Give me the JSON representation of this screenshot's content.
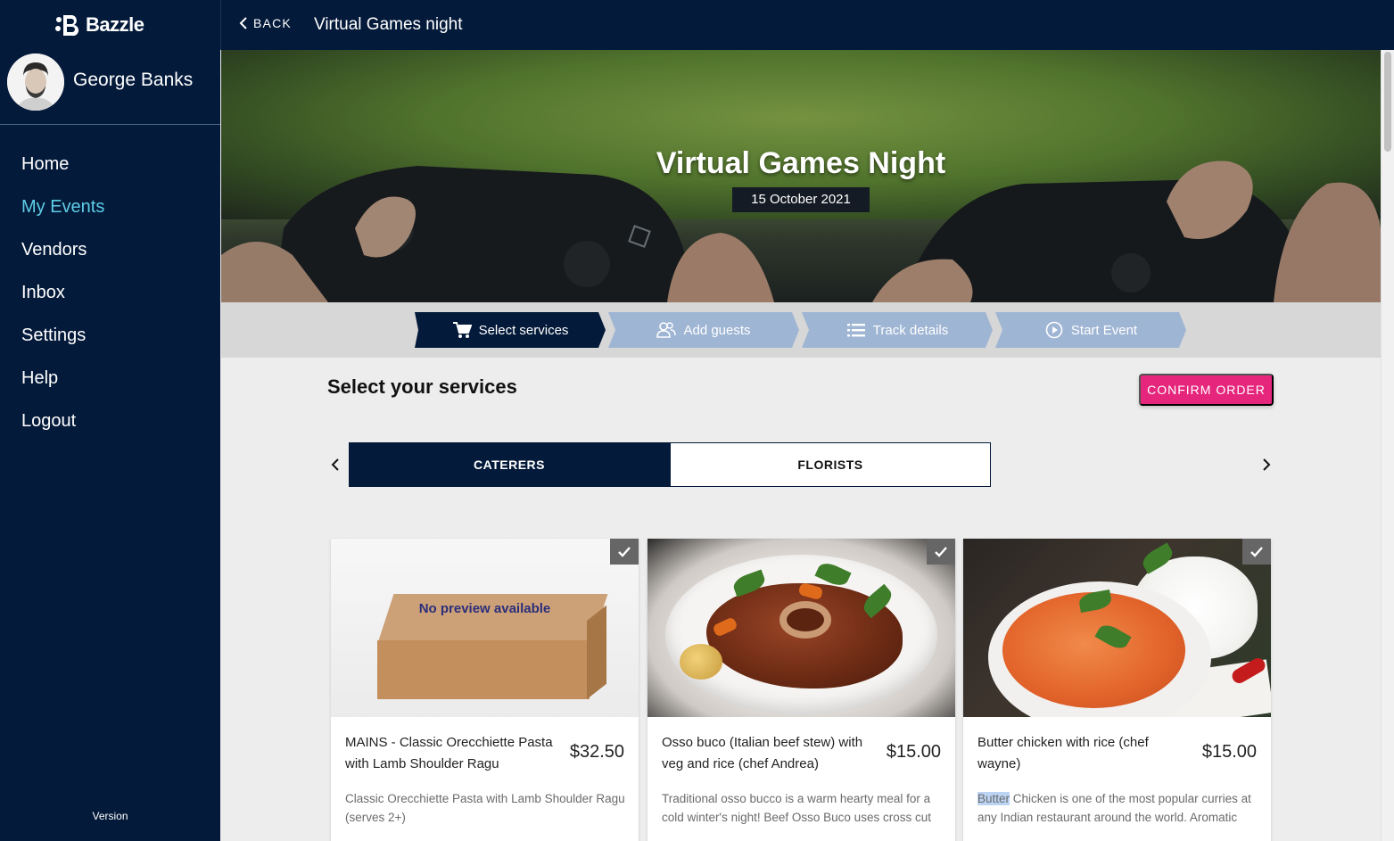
{
  "app": {
    "logo_text": "Bazzle"
  },
  "user": {
    "name": "George Banks"
  },
  "sidebar": {
    "items": [
      {
        "label": "Home",
        "active": false
      },
      {
        "label": "My Events",
        "active": true
      },
      {
        "label": "Vendors",
        "active": false
      },
      {
        "label": "Inbox",
        "active": false
      },
      {
        "label": "Settings",
        "active": false
      },
      {
        "label": "Help",
        "active": false
      },
      {
        "label": "Logout",
        "active": false
      }
    ],
    "version_label": "Version"
  },
  "topbar": {
    "back_label": "BACK",
    "title": "Virtual Games night"
  },
  "hero": {
    "title": "Virtual Games Night",
    "date": "15 October 2021"
  },
  "steps": [
    {
      "label": "Select services",
      "icon": "cart-icon",
      "active": true
    },
    {
      "label": "Add guests",
      "icon": "users-icon",
      "active": false
    },
    {
      "label": "Track details",
      "icon": "list-icon",
      "active": false
    },
    {
      "label": "Start Event",
      "icon": "play-icon",
      "active": false
    }
  ],
  "main": {
    "section_title": "Select your services",
    "confirm_button": "CONFIRM ORDER",
    "tabs": [
      {
        "label": "CATERERS",
        "active": true
      },
      {
        "label": "FLORISTS",
        "active": false
      }
    ]
  },
  "cards": [
    {
      "title": "MAINS - Classic Orecchiette Pasta with Lamb Shoulder Ragu",
      "price": "$32.50",
      "description": "Classic Orecchiette Pasta with Lamb Shoulder Ragu (serves 2+)",
      "image_text": "No preview available",
      "checked": true
    },
    {
      "title": "Osso buco (Italian beef stew) with veg and rice (chef Andrea)",
      "price": "$15.00",
      "description": "Traditional osso bucco is a warm hearty meal for a cold winter's night! Beef Osso Buco uses cross cut",
      "checked": true
    },
    {
      "title": "Butter chicken with rice (chef wayne)",
      "price": "$15.00",
      "description_highlight": "Butter",
      "description_rest": " Chicken is one of the most popular curries at any Indian restaurant around the world. Aromatic",
      "checked": true
    }
  ],
  "colors": {
    "navy": "#041a3a",
    "accent_cyan": "#5ecde6",
    "confirm_pink": "#e6267c",
    "step_inactive": "#9fb5d4"
  }
}
